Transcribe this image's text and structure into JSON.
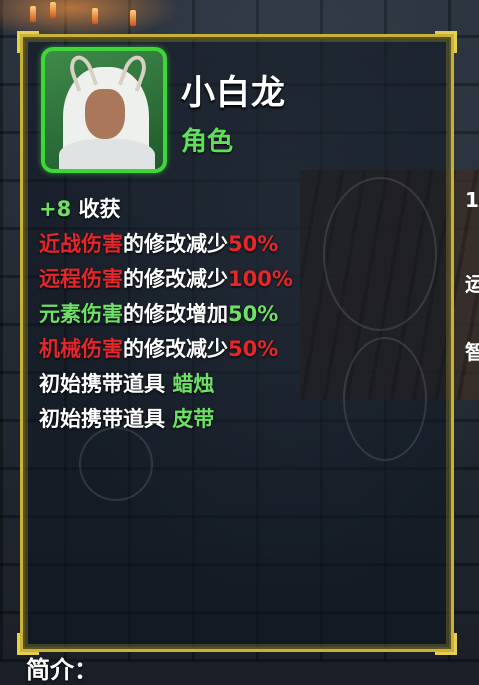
{
  "character": {
    "name": "小白龙",
    "type": "角色"
  },
  "stats": [
    {
      "prefix": "+8",
      "label": " 收获",
      "suffix": ""
    },
    {
      "prefix": "近战伤害",
      "label": "的修改减少",
      "suffix": "50%"
    },
    {
      "prefix": "远程伤害",
      "label": "的修改减少",
      "suffix": "100%"
    },
    {
      "prefix": "元素伤害",
      "label": "的修改增加",
      "suffix": "50%"
    },
    {
      "prefix": "机械伤害",
      "label": "的修改减少",
      "suffix": "50%"
    },
    {
      "prefix": "",
      "label": "初始携带道具 ",
      "suffix": "蜡烛"
    },
    {
      "prefix": "",
      "label": "初始携带道具 ",
      "suffix": "皮带"
    }
  ],
  "bottom_partial": "简介：",
  "side_partial": [
    "1",
    "运",
    "智"
  ],
  "colors": {
    "frame": "#c9b23a",
    "portrait_border": "#3fd63a",
    "positive": "#6fe066",
    "negative": "#e5262a"
  },
  "icons": {
    "portrait": "white-haired-dragon-character-portrait"
  }
}
